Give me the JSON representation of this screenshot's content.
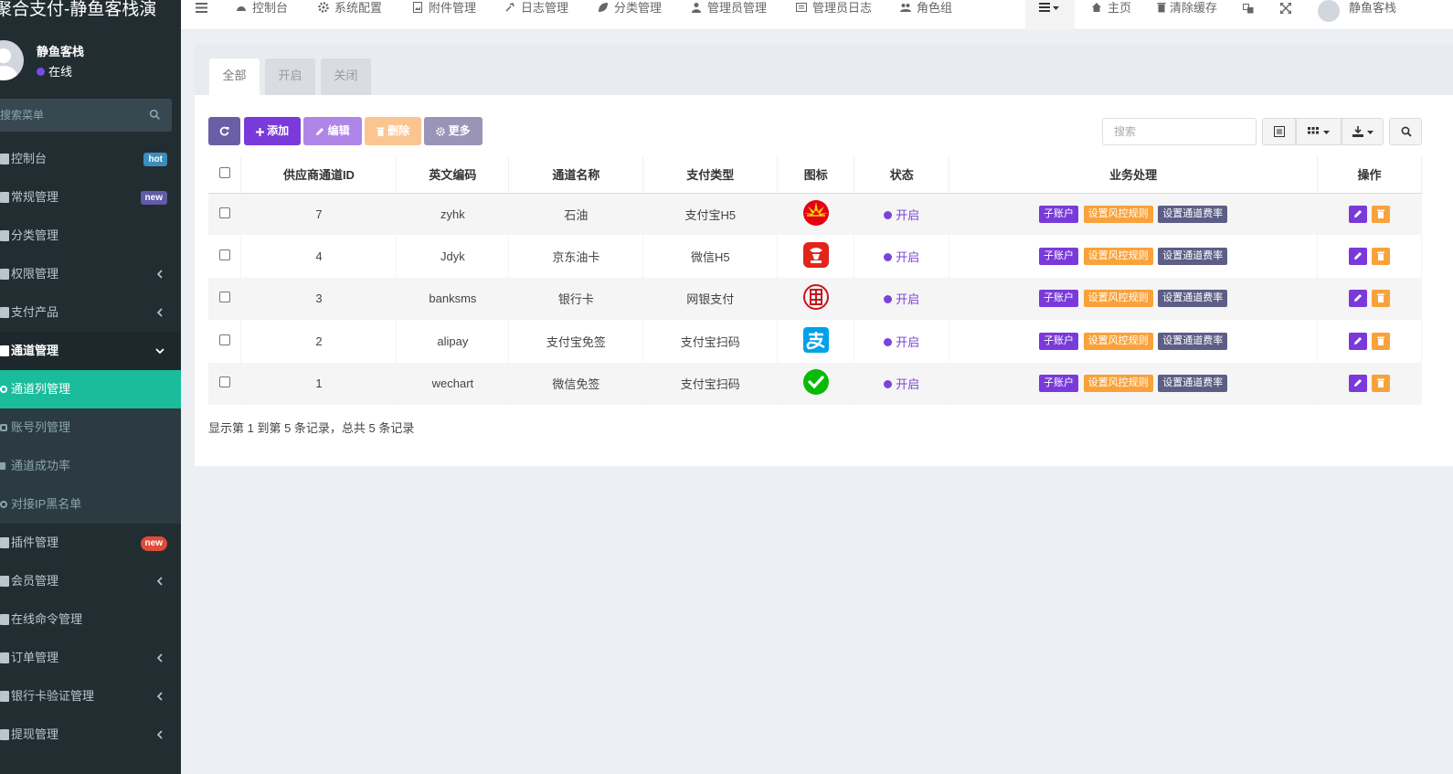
{
  "app": {
    "title": "聚合支付-静鱼客栈演"
  },
  "user": {
    "name": "静鱼客栈",
    "status": "在线"
  },
  "sidebar": {
    "search_placeholder": "搜索菜单",
    "items": [
      {
        "label": "控制台",
        "badge": "hot",
        "icon": "dashboard-icon"
      },
      {
        "label": "常规管理",
        "badge": "new",
        "icon": "cogs-icon"
      },
      {
        "label": "分类管理",
        "icon": "leaf-icon"
      },
      {
        "label": "权限管理",
        "icon": "group-icon"
      },
      {
        "label": "支付产品",
        "icon": "credit-card-icon"
      },
      {
        "label": "通道管理",
        "icon": "channel-icon"
      },
      {
        "label": "通道列管理",
        "icon": "circle-icon"
      },
      {
        "label": "账号列管理",
        "icon": "user-icon"
      },
      {
        "label": "通道成功率",
        "icon": "bar-chart-icon"
      },
      {
        "label": "对接IP黑名单",
        "icon": "circle-icon"
      },
      {
        "label": "插件管理",
        "badge": "new",
        "icon": "rocket-icon"
      },
      {
        "label": "会员管理",
        "icon": "user-icon"
      },
      {
        "label": "在线命令管理",
        "icon": "terminal-icon"
      },
      {
        "label": "订单管理",
        "icon": "list-icon"
      },
      {
        "label": "银行卡验证管理",
        "icon": "bank-icon"
      },
      {
        "label": "提现管理",
        "icon": "money-icon"
      }
    ]
  },
  "header": {
    "nav": [
      "控制台",
      "系统配置",
      "附件管理",
      "日志管理",
      "分类管理",
      "管理员管理",
      "管理员日志",
      "角色组"
    ],
    "home": "主页",
    "clear_cache": "清除缓存",
    "user_name": "静鱼客栈"
  },
  "tabs": [
    "全部",
    "开启",
    "关闭"
  ],
  "toolbar": {
    "add": "添加",
    "edit": "编辑",
    "delete": "删除",
    "more": "更多",
    "search_placeholder": "搜索"
  },
  "table": {
    "columns": [
      "供应商通道ID",
      "英文编码",
      "通道名称",
      "支付类型",
      "图标",
      "状态",
      "业务处理",
      "操作"
    ],
    "rows": [
      {
        "id": "7",
        "code": "zyhk",
        "name": "石油",
        "pay_type": "支付宝H5",
        "icon": "petrochina-icon",
        "status": "开启"
      },
      {
        "id": "4",
        "code": "Jdyk",
        "name": "京东油卡",
        "pay_type": "微信H5",
        "icon": "jd-icon",
        "status": "开启"
      },
      {
        "id": "3",
        "code": "banksms",
        "name": "银行卡",
        "pay_type": "网银支付",
        "icon": "unionpay-icon",
        "status": "开启"
      },
      {
        "id": "2",
        "code": "alipay",
        "name": "支付宝免签",
        "pay_type": "支付宝扫码",
        "icon": "alipay-icon",
        "status": "开启"
      },
      {
        "id": "1",
        "code": "wechart",
        "name": "微信免签",
        "pay_type": "支付宝扫码",
        "icon": "wechat-icon",
        "status": "开启"
      }
    ],
    "actions": {
      "sub_account": "子账户",
      "risk_rule": "设置风控规则",
      "rate": "设置通道费率"
    }
  },
  "footer": {
    "summary": "显示第 1 到第 5 条记录，总共 5 条记录"
  },
  "colors": {
    "sidebar": "#222d32",
    "active": "#1abc9c",
    "purple": "#7a3ad9",
    "orange": "#f9a23b",
    "slate": "#5d5e86"
  }
}
